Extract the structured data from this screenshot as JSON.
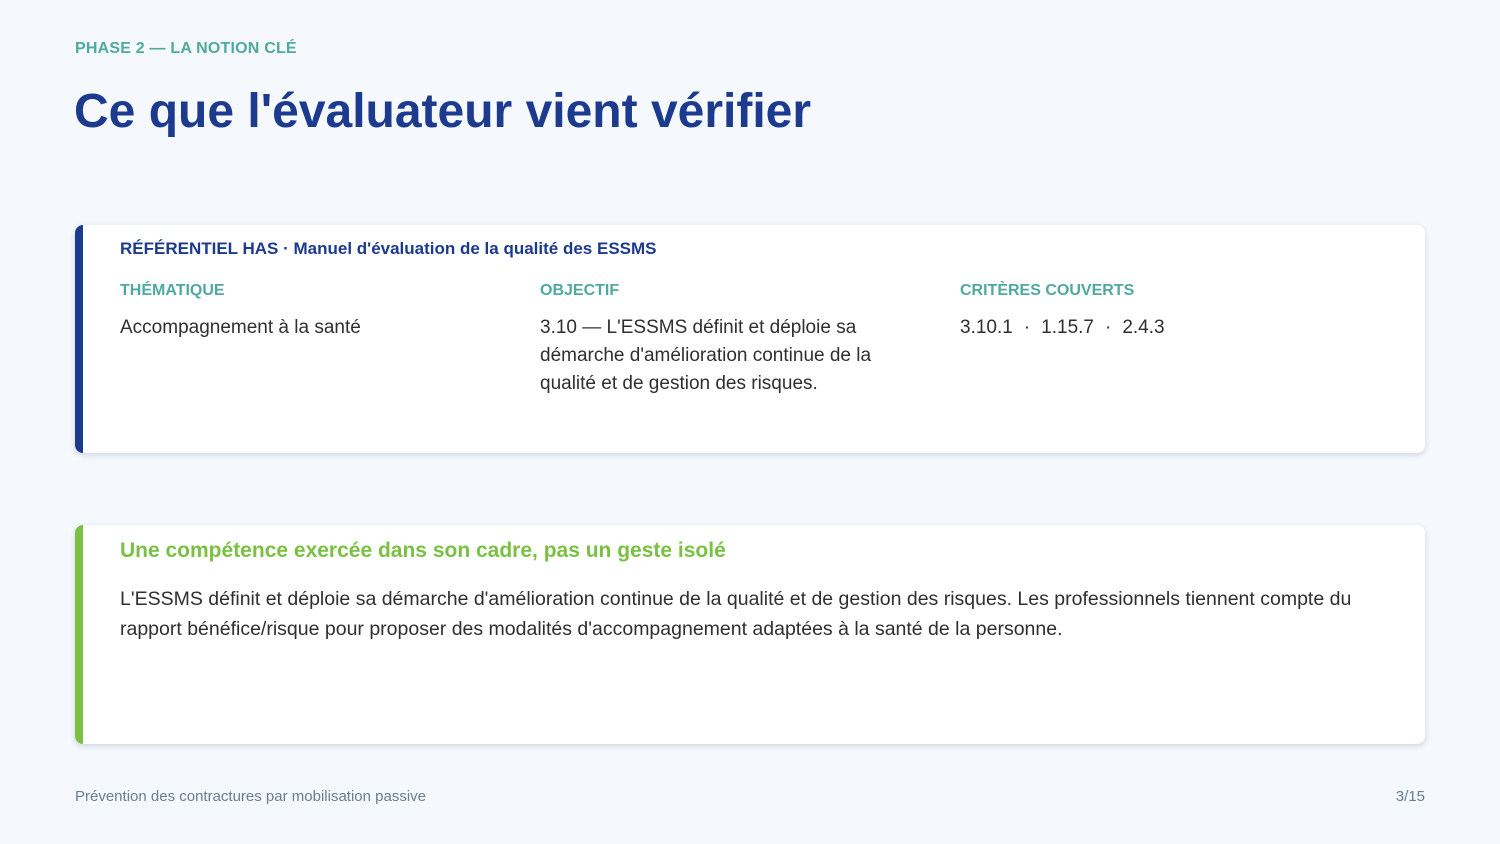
{
  "eyebrow": "PHASE 2 — LA NOTION CLÉ",
  "title": "Ce que l'évaluateur vient vérifier",
  "referentiel": {
    "heading": "RÉFÉRENTIEL HAS · Manuel d'évaluation de la qualité des ESSMS",
    "thematique_label": "THÉMATIQUE",
    "thematique_value": "Accompagnement à la santé",
    "objectif_label": "OBJECTIF",
    "objectif_value": "3.10 — L'ESSMS définit et déploie sa démarche d'amélioration continue de la qualité et de gestion des risques.",
    "criteres_label": "CRITÈRES COUVERTS",
    "criteres": [
      "3.10.1",
      "1.15.7",
      "2.4.3"
    ],
    "separator": "·"
  },
  "competence": {
    "heading": "Une compétence exercée dans son cadre, pas un geste isolé",
    "text": "L'ESSMS définit et déploie sa démarche d'amélioration continue de la qualité et de gestion des risques. Les professionnels tiennent compte du rapport bénéfice/risque pour proposer des modalités d'accompagnement adaptées à la santé de la personne."
  },
  "footer": {
    "title": "Prévention des contractures par mobilisation passive",
    "page": "3/15"
  },
  "colors": {
    "primary": "#1c3a8e",
    "teal": "#4fa9a0",
    "green": "#7ac143",
    "background": "#f5f8fc"
  }
}
